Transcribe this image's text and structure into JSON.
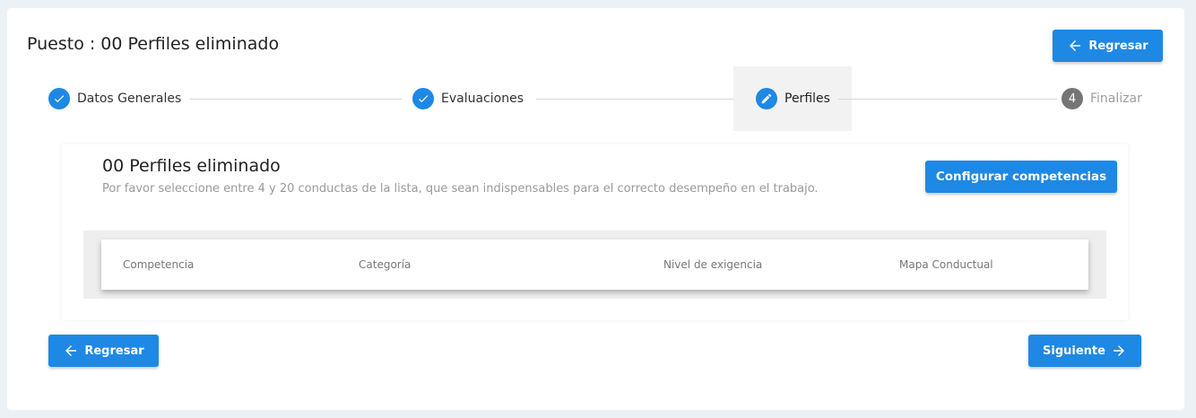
{
  "header": {
    "title": "Puesto : 00 Perfiles eliminado",
    "back_label": "Regresar"
  },
  "stepper": {
    "steps": [
      {
        "label": "Datos Generales",
        "state": "completed",
        "icon": "check-icon"
      },
      {
        "label": "Evaluaciones",
        "state": "completed",
        "icon": "check-icon"
      },
      {
        "label": "Perfiles",
        "state": "active",
        "icon": "pencil-icon"
      },
      {
        "label": "Finalizar",
        "state": "pending",
        "number": "4"
      }
    ]
  },
  "profile": {
    "title": "00 Perfiles eliminado",
    "description": "Por favor seleccione entre 4 y 20 conductas de la lista, que sean indispensables para el correcto desempeño en el trabajo.",
    "config_label": "Configurar competencias"
  },
  "table": {
    "columns": [
      "Competencia",
      "Categoría",
      "Nivel de exigencia",
      "Mapa Conductual"
    ],
    "rows": []
  },
  "footer": {
    "back_label": "Regresar",
    "next_label": "Siguiente"
  },
  "colors": {
    "accent": "#1e88e5",
    "background": "#ecf1f5",
    "pending_step": "#757575"
  }
}
